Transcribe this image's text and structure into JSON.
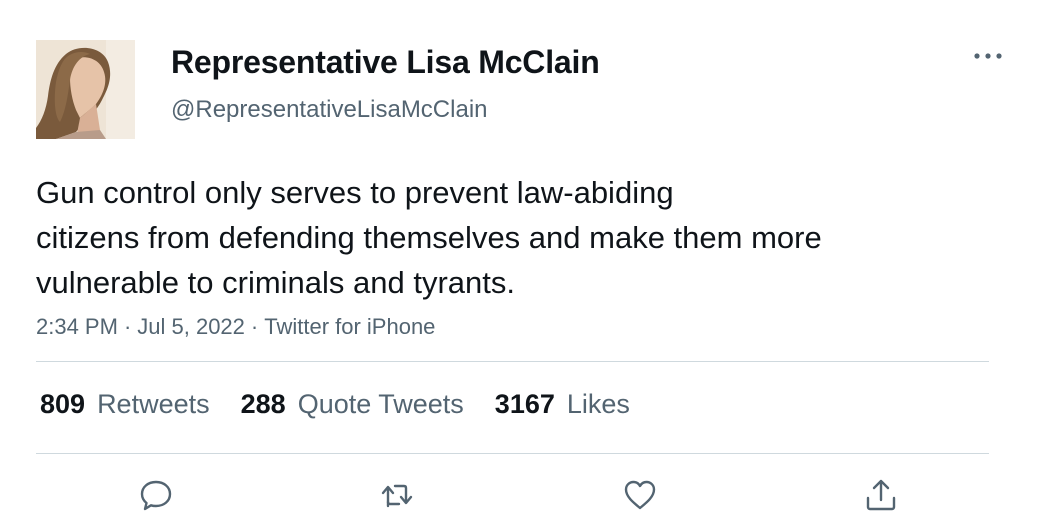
{
  "author": {
    "display_name": "Representative Lisa McClain",
    "handle": "@RepresentativeLisaMcClain",
    "avatar_icon": "profile-photo"
  },
  "tweet": {
    "text_lines": [
      "Gun control only serves to prevent law-abiding",
      "citizens from defending themselves and make them more",
      "vulnerable to criminals and tyrants."
    ],
    "time": "2:34 PM",
    "separator": "·",
    "date": "Jul 5, 2022",
    "source": "Twitter for iPhone"
  },
  "stats": {
    "retweets": {
      "count": "809",
      "label": "Retweets"
    },
    "quote_tweets": {
      "count": "288",
      "label": "Quote Tweets"
    },
    "likes": {
      "count": "3167",
      "label": "Likes"
    }
  },
  "actions": [
    "reply-icon",
    "retweet-icon",
    "like-icon",
    "share-icon"
  ],
  "colors": {
    "text_primary": "#0f1419",
    "text_secondary": "#536471",
    "divider": "#cfd9de",
    "background": "#ffffff"
  }
}
